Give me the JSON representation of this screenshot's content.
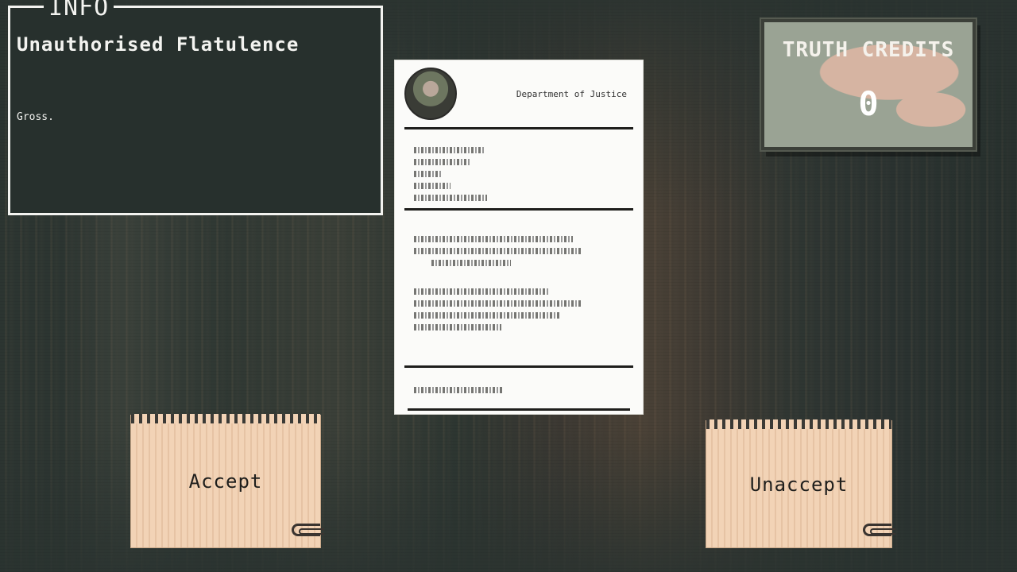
{
  "info": {
    "tag": "INFO",
    "title": "Unauthorised Flatulence",
    "description": "Gross."
  },
  "document": {
    "header": "Department of Justice"
  },
  "credits": {
    "title": "TRUTH CREDITS",
    "value": "0"
  },
  "buttons": {
    "accept": "Accept",
    "unaccept": "Unaccept"
  },
  "colors": {
    "panel_bg": "#27302d",
    "panel_border": "#f3f3f0",
    "notepad": "#f2d3b6",
    "credits_bg": "#9aa394"
  }
}
